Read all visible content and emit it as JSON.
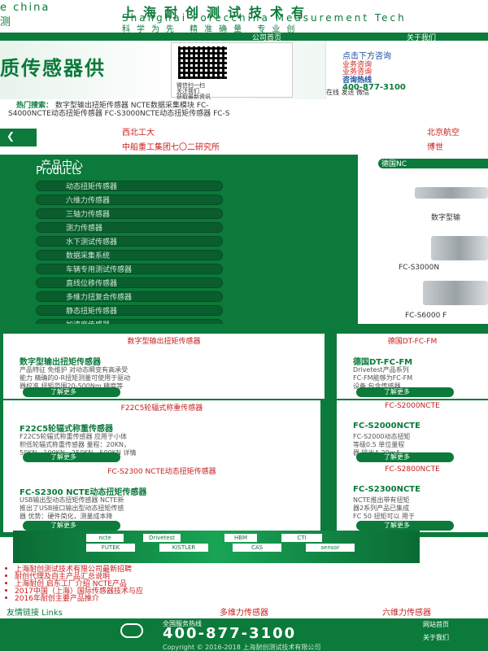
{
  "header": {
    "en_brand": "e china",
    "cn_brand": "测",
    "title_cn": "上海耐创测试技术有",
    "title_en": "Shanghai Forecchina Measurement Tech",
    "slogan": "科学为先 精准确量 专业创"
  },
  "nav": {
    "item_a": "公司首页",
    "item_b": "关于我们"
  },
  "banner": {
    "headline": "质传感器供",
    "qr": {
      "line1": "微信扫一扫",
      "line2": "关注我们",
      "line3": "获取最新资讯"
    },
    "contact": {
      "head": "点击下方咨询",
      "line1": "业务咨询",
      "line2": "业务咨询",
      "line3": "咨询热线",
      "phone": "400-877-3100",
      "btns": "在线     发送    微信"
    }
  },
  "hot": {
    "label": "热门搜索：",
    "row1_rest": "数字型输出扭矩传感器    NCTE数据采集模块    FC-",
    "row2": "S4000NCTE动态扭矩传感器    FC-S3000NCTE动态扭矩传感器    FC-S"
  },
  "clients": {
    "c1": "西北工大",
    "c2": "北京航空",
    "c3": "中船重工集团七〇二研究所",
    "c4": "博世"
  },
  "products": {
    "heading_cn": "产品中心",
    "heading_en": "Products",
    "items": [
      "动态扭矩传感器",
      "六维力传感器",
      "三轴力传感器",
      "测力传感器",
      "水下测试传感器",
      "数据采集系统",
      "车辆专用测试传感器",
      "直线位移传感器",
      "多维力扭复合传感器",
      "静态扭矩传感器",
      "加速度传感器"
    ]
  },
  "rightcol": {
    "tag": "德国NC",
    "cap1": "数字型输",
    "cap2": "FC-S3000N",
    "cap3": "FC-S6000 F"
  },
  "cards": [
    {
      "cat": "数字型输出扭矩传感器",
      "name": "数字型输出扭矩传感器",
      "desc1": "产品特征 免维护 对动态瞬变有高承受",
      "desc2": "能力 精确的0-R扭矩测量可使用于驱动",
      "desc3": "器校准 扭矩范围20-500Nm 精度等",
      "btn": "了解更多"
    },
    {
      "cat": "德国DT-FC-FM",
      "name": "德国DT-FC-FM",
      "desc1": "Drivetest产品系列",
      "desc2": "FC-FM能够为FC-FM",
      "desc3": "设备 包含传感器",
      "btn": "了解更多"
    },
    {
      "cat": "F22C5轮辐式称重传感器",
      "name": "F22C5轮辐式称重传感器",
      "desc1": "F22C5轮辐式称重传感器 应用于小体",
      "desc2": "积低轮辐式称重传感器 量程：20KN，",
      "desc3": "50KN，100KN，250KN，500KN 详情",
      "btn": "了解更多"
    },
    {
      "cat": "FC-S2000NCTE",
      "name": "FC-S2000NCTE",
      "desc1": "FC-S2000动态扭矩",
      "desc2": "等级0.5 单位量程",
      "desc3": "器 输出4-20mA",
      "btn": "了解更多"
    },
    {
      "cat": "FC-S2300 NCTE动态扭矩传感器",
      "name": "FC-S2300 NCTE动态扭矩传感器",
      "desc1": "USB输出型动态扭矩传感器 NCTE新",
      "desc2": "推出了USB接口输出型动态扭矩传感",
      "desc3": "器 优势：硬件简化，测量成本降",
      "btn": "了解更多"
    },
    {
      "cat": "FC-S2800NCTE",
      "name": "FC-S2300NCTE",
      "desc1": "NCTE推出带有扭矩",
      "desc2": "器2系列产品已集成",
      "desc3": "FC 50 扭矩可以 用于",
      "btn": "了解更多"
    }
  ],
  "brandbar": {
    "logos": [
      "ncte",
      "Drivetest",
      "HBM",
      "CTI",
      "FUTEK",
      "KISTLER",
      "CAS",
      "sensor"
    ]
  },
  "news": [
    "上海耐创测试技术有限公司最新招聘",
    "耐创代理及自主产品汇总说明",
    "上海耐创 启东工厂介绍 NCTE产品",
    "2017中国（上海）国际传感器技术与应",
    "2016年耐创主要产品推介"
  ],
  "links": {
    "label": "友情链接 Links",
    "l1": "多维力传感器",
    "l2": "六维力传感器"
  },
  "footer": {
    "phone_label": "全国服务热线",
    "phone": "400-877-3100",
    "copy": "Copyright © 2016-2018 上海耐创测试技术有限公司",
    "right1": "网站首页",
    "right2": "关于我们"
  }
}
